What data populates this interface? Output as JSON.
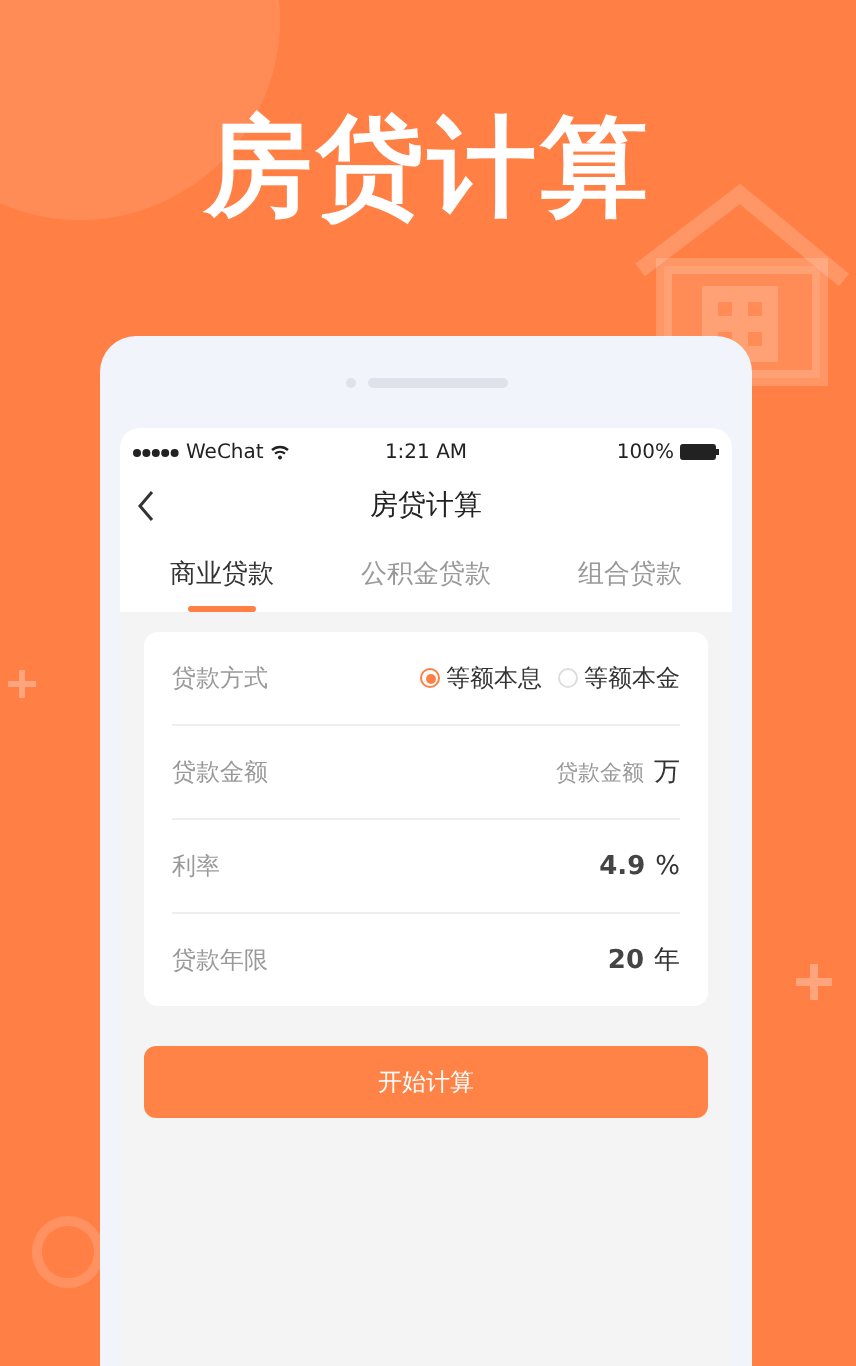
{
  "headline": "房贷计算",
  "status_bar": {
    "carrier": "WeChat",
    "time": "1:21 AM",
    "battery": "100%"
  },
  "nav": {
    "title": "房贷计算"
  },
  "tabs": [
    {
      "label": "商业贷款",
      "selected": true
    },
    {
      "label": "公积金贷款",
      "selected": false
    },
    {
      "label": "组合贷款",
      "selected": false
    }
  ],
  "form": [
    {
      "kind": "radio",
      "label": "贷款方式",
      "options": [
        {
          "label": "等额本息",
          "selected": true
        },
        {
          "label": "等额本金",
          "selected": false
        }
      ]
    },
    {
      "kind": "input",
      "label": "贷款金额",
      "placeholder": "贷款金额",
      "unit": "万"
    },
    {
      "kind": "value",
      "label": "利率",
      "value": "4.9",
      "unit": "%"
    },
    {
      "kind": "value",
      "label": "贷款年限",
      "value": "20",
      "unit": "年"
    }
  ],
  "button": "开始计算"
}
